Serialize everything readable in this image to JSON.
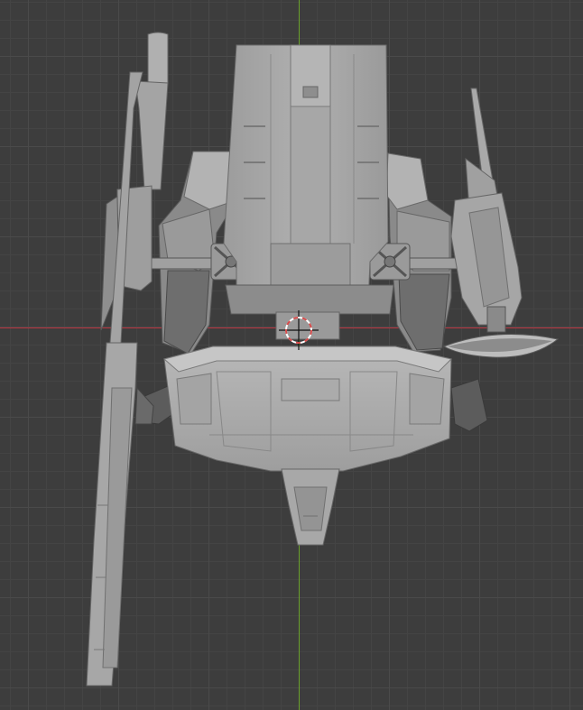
{
  "viewport": {
    "view": "top-orthographic",
    "grid": true,
    "colors": {
      "background": "#3d3d3d",
      "grid_major": "#4a4a4a",
      "grid_minor": "#444444",
      "x_axis": "#b8333f",
      "y_axis": "#6aa12c",
      "model": "#a9a9a9",
      "model_shadow": "#7e7e7e",
      "model_dark": "#4f4f4f",
      "model_light": "#c4c4c4"
    }
  },
  "scene": {
    "object": "mech-model",
    "parts": [
      "backpack",
      "left-long-cannon",
      "right-blade-shield",
      "left-shoulder-armor",
      "right-shoulder-armor",
      "skirt-armor",
      "rear-tail-fin",
      "hip-joint-left",
      "hip-joint-right"
    ]
  },
  "cursor_3d": {
    "icon": "3d-cursor-icon",
    "ring_colors": [
      "#d64a4a",
      "#ffffff"
    ]
  }
}
